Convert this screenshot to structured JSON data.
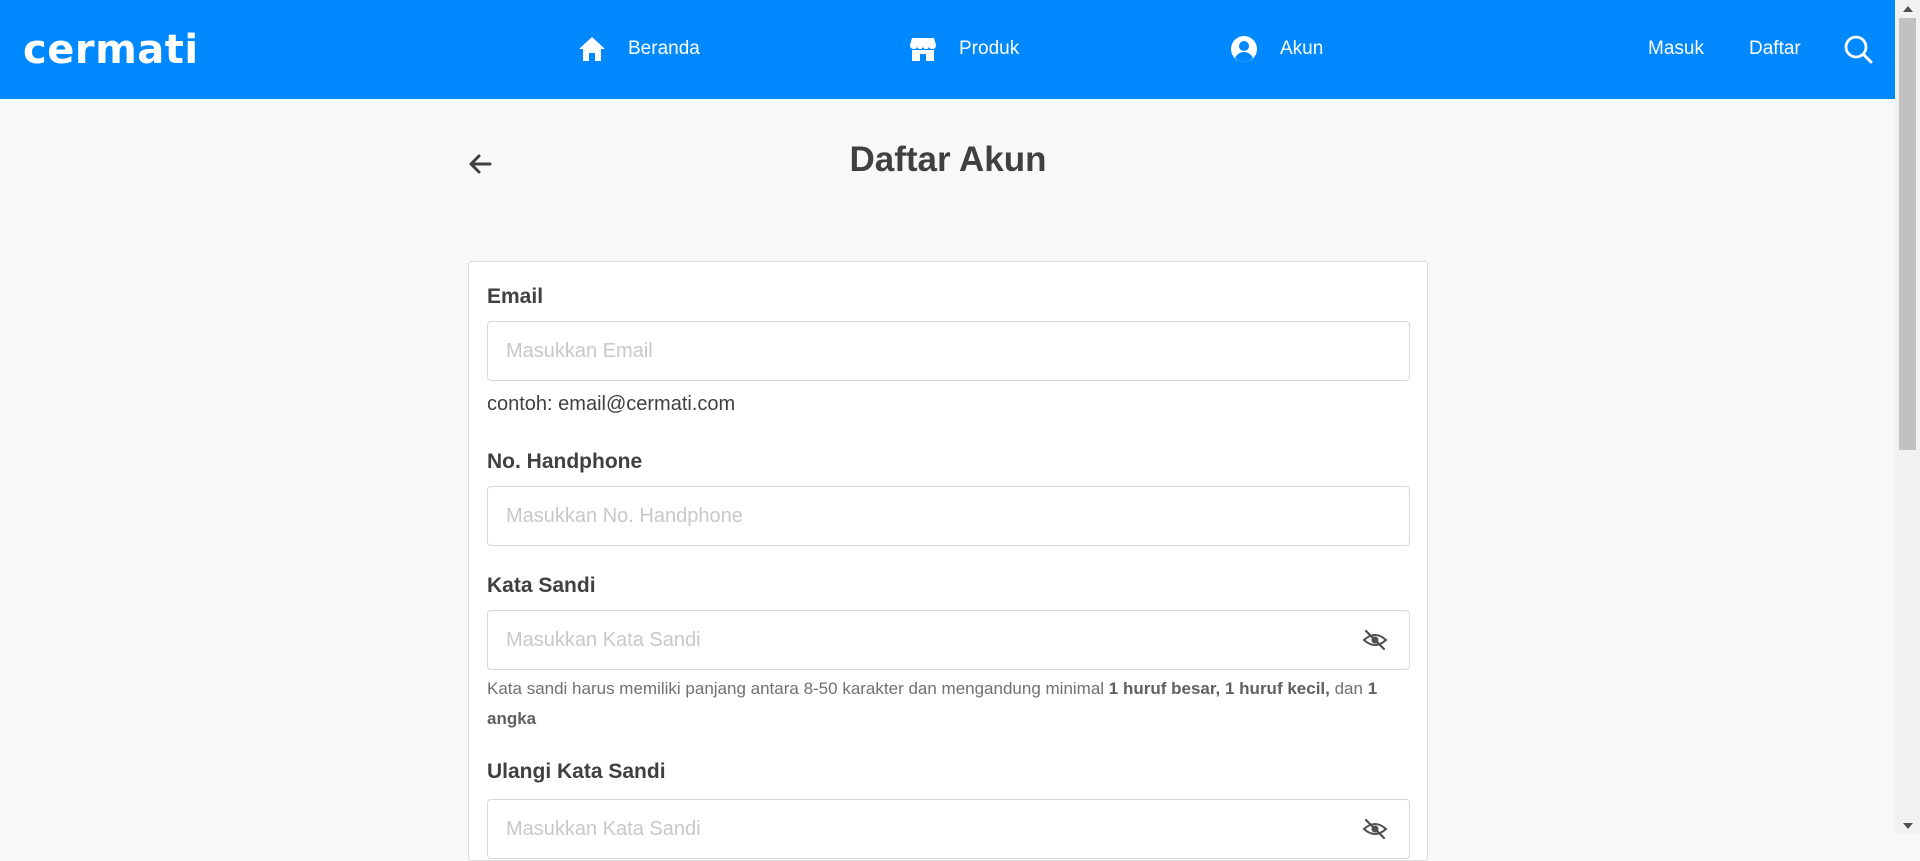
{
  "navbar": {
    "logo": "cermati",
    "items": [
      {
        "label": "Beranda",
        "icon": "home-icon"
      },
      {
        "label": "Produk",
        "icon": "store-icon"
      },
      {
        "label": "Akun",
        "icon": "user-circle-icon"
      }
    ],
    "masuk": "Masuk",
    "daftar": "Daftar",
    "search_icon": "search-icon",
    "background_color": "#0088ff"
  },
  "page": {
    "title": "Daftar Akun",
    "back_icon": "arrow-left-icon"
  },
  "form": {
    "email": {
      "label": "Email",
      "placeholder": "Masukkan Email",
      "value": "",
      "hint": "contoh: email@cermati.com"
    },
    "phone": {
      "label": "No. Handphone",
      "placeholder": "Masukkan No. Handphone",
      "value": ""
    },
    "password": {
      "label": "Kata Sandi",
      "placeholder": "Masukkan Kata Sandi",
      "value": "",
      "hint_part1": "Kata sandi harus memiliki panjang antara 8-50 karakter dan mengandung minimal ",
      "hint_bold1": "1 huruf besar, 1 huruf kecil,",
      "hint_part2": " dan ",
      "hint_bold2": "1 angka",
      "toggle_icon": "eye-slash-icon"
    },
    "confirm_password": {
      "label": "Ulangi Kata Sandi",
      "placeholder": "Masukkan Kata Sandi",
      "value": "",
      "toggle_icon": "eye-slash-icon"
    }
  }
}
